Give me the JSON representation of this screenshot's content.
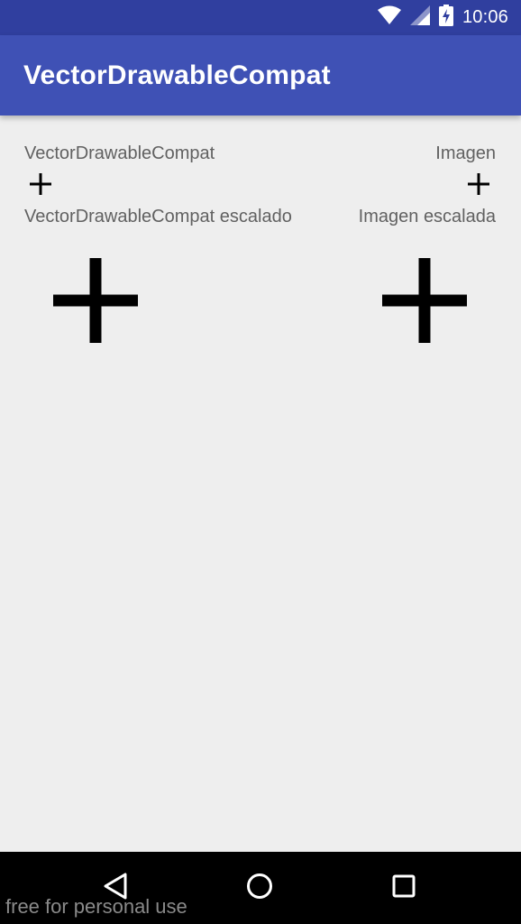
{
  "status_bar": {
    "time": "10:06",
    "icons": [
      "wifi-icon",
      "cell-signal-icon",
      "battery-charging-icon"
    ]
  },
  "app_bar": {
    "title": "VectorDrawableCompat"
  },
  "content": {
    "row1": {
      "left_label": "VectorDrawableCompat",
      "right_label": "Imagen"
    },
    "row2": {
      "left_label": "VectorDrawableCompat escalado",
      "right_label": "Imagen escalada"
    }
  },
  "nav_bar": {
    "buttons": [
      "back-icon",
      "home-icon",
      "recents-icon"
    ]
  },
  "watermark": "free for personal use",
  "colors": {
    "status_bar": "#303f9f",
    "app_bar": "#3f51b5",
    "background": "#eeeeee",
    "text_secondary": "#616161",
    "nav_bar": "#000000"
  }
}
